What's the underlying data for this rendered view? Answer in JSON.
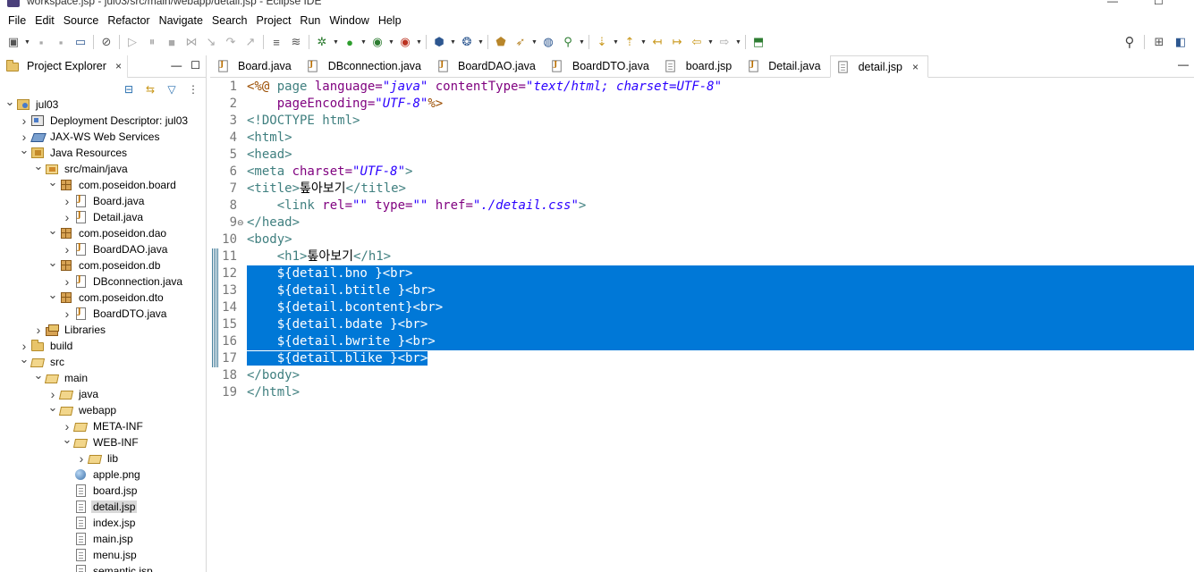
{
  "titlebar": {
    "text": "workspace.jsp - jul03/src/main/webapp/detail.jsp - Eclipse IDE",
    "minimize": "—",
    "maximize": "☐"
  },
  "menu": [
    "File",
    "Edit",
    "Source",
    "Refactor",
    "Navigate",
    "Search",
    "Project",
    "Run",
    "Window",
    "Help"
  ],
  "explorer": {
    "tab_label": "Project Explorer",
    "close": "×",
    "minimize": "—",
    "maximize": "☐",
    "tree": [
      {
        "label": "jul03",
        "level": 0,
        "twisty": "open",
        "icon": "project"
      },
      {
        "label": "Deployment Descriptor: jul03",
        "level": 1,
        "twisty": "closed",
        "icon": "deployment-descriptor"
      },
      {
        "label": "JAX-WS Web Services",
        "level": 1,
        "twisty": "closed",
        "icon": "web-services"
      },
      {
        "label": "Java Resources",
        "level": 1,
        "twisty": "open",
        "icon": "java-resources"
      },
      {
        "label": "src/main/java",
        "level": 2,
        "twisty": "open",
        "icon": "source-folder"
      },
      {
        "label": "com.poseidon.board",
        "level": 3,
        "twisty": "open",
        "icon": "package"
      },
      {
        "label": "Board.java",
        "level": 4,
        "twisty": "closed",
        "icon": "java-file"
      },
      {
        "label": "Detail.java",
        "level": 4,
        "twisty": "closed",
        "icon": "java-file"
      },
      {
        "label": "com.poseidon.dao",
        "level": 3,
        "twisty": "open",
        "icon": "package"
      },
      {
        "label": "BoardDAO.java",
        "level": 4,
        "twisty": "closed",
        "icon": "java-file"
      },
      {
        "label": "com.poseidon.db",
        "level": 3,
        "twisty": "open",
        "icon": "package"
      },
      {
        "label": "DBconnection.java",
        "level": 4,
        "twisty": "closed",
        "icon": "java-file"
      },
      {
        "label": "com.poseidon.dto",
        "level": 3,
        "twisty": "open",
        "icon": "package"
      },
      {
        "label": "BoardDTO.java",
        "level": 4,
        "twisty": "closed",
        "icon": "java-file"
      },
      {
        "label": "Libraries",
        "level": 2,
        "twisty": "closed",
        "icon": "libraries"
      },
      {
        "label": "build",
        "level": 1,
        "twisty": "closed",
        "icon": "folder"
      },
      {
        "label": "src",
        "level": 1,
        "twisty": "open",
        "icon": "open-folder"
      },
      {
        "label": "main",
        "level": 2,
        "twisty": "open",
        "icon": "open-folder"
      },
      {
        "label": "java",
        "level": 3,
        "twisty": "closed",
        "icon": "open-folder"
      },
      {
        "label": "webapp",
        "level": 3,
        "twisty": "open",
        "icon": "open-folder"
      },
      {
        "label": "META-INF",
        "level": 4,
        "twisty": "closed",
        "icon": "open-folder"
      },
      {
        "label": "WEB-INF",
        "level": 4,
        "twisty": "open",
        "icon": "open-folder"
      },
      {
        "label": "lib",
        "level": 5,
        "twisty": "closed",
        "icon": "open-folder"
      },
      {
        "label": "apple.png",
        "level": 4,
        "twisty": "none",
        "icon": "image-file"
      },
      {
        "label": "board.jsp",
        "level": 4,
        "twisty": "none",
        "icon": "jsp-file"
      },
      {
        "label": "detail.jsp",
        "level": 4,
        "twisty": "none",
        "icon": "jsp-file",
        "selected": true
      },
      {
        "label": "index.jsp",
        "level": 4,
        "twisty": "none",
        "icon": "jsp-file"
      },
      {
        "label": "main.jsp",
        "level": 4,
        "twisty": "none",
        "icon": "jsp-file"
      },
      {
        "label": "menu.jsp",
        "level": 4,
        "twisty": "none",
        "icon": "jsp-file"
      },
      {
        "label": "semantic.jsp",
        "level": 4,
        "twisty": "none",
        "icon": "jsp-file"
      }
    ]
  },
  "editor": {
    "tabs": [
      {
        "label": "Board.java",
        "icon": "java-file",
        "active": false
      },
      {
        "label": "DBconnection.java",
        "icon": "java-file",
        "active": false
      },
      {
        "label": "BoardDAO.java",
        "icon": "java-file",
        "active": false
      },
      {
        "label": "BoardDTO.java",
        "icon": "java-file",
        "active": false
      },
      {
        "label": "board.jsp",
        "icon": "jsp-file",
        "active": false
      },
      {
        "label": "Detail.java",
        "icon": "java-file",
        "active": false
      },
      {
        "label": "detail.jsp",
        "icon": "jsp-file",
        "active": true
      }
    ],
    "tab_close": "×",
    "minimize": "—",
    "lines": [
      [
        {
          "t": "<%@ ",
          "c": "jsp"
        },
        {
          "t": "page ",
          "c": "tag"
        },
        {
          "t": "language=",
          "c": "attr"
        },
        {
          "t": "\"java\"",
          "c": "val"
        },
        {
          "t": " contentType=",
          "c": "attr"
        },
        {
          "t": "\"text/html; charset=UTF-8\"",
          "c": "val"
        }
      ],
      [
        {
          "t": "    pageEncoding=",
          "c": "attr"
        },
        {
          "t": "\"UTF-8\"",
          "c": "val"
        },
        {
          "t": "%>",
          "c": "jsp"
        }
      ],
      [
        {
          "t": "<!DOCTYPE html>",
          "c": "tag"
        }
      ],
      [
        {
          "t": "<html>",
          "c": "tag"
        }
      ],
      [
        {
          "t": "<head>",
          "c": "tag"
        }
      ],
      [
        {
          "t": "<meta ",
          "c": "tag"
        },
        {
          "t": "charset=",
          "c": "attr"
        },
        {
          "t": "\"UTF-8\"",
          "c": "val"
        },
        {
          "t": ">",
          "c": "tag"
        }
      ],
      [
        {
          "t": "<title>",
          "c": "tag"
        },
        {
          "t": "톺아보기",
          "c": "kor"
        },
        {
          "t": "</title>",
          "c": "tag"
        }
      ],
      [
        {
          "t": "    <link ",
          "c": "tag"
        },
        {
          "t": "rel=",
          "c": "attr"
        },
        {
          "t": "\"\"",
          "c": "val"
        },
        {
          "t": " type=",
          "c": "attr"
        },
        {
          "t": "\"\"",
          "c": "val"
        },
        {
          "t": " href=",
          "c": "attr"
        },
        {
          "t": "\"./detail.css\"",
          "c": "val"
        },
        {
          "t": ">",
          "c": "tag"
        }
      ],
      [
        {
          "t": "</head>",
          "c": "tag"
        }
      ],
      [
        {
          "t": "<body>",
          "c": "tag"
        }
      ],
      [
        {
          "t": "    <h1>",
          "c": "tag"
        },
        {
          "t": "톺아보기",
          "c": "kor"
        },
        {
          "t": "</h1>",
          "c": "tag"
        }
      ],
      [
        {
          "t": "    ${detail.bno }",
          "c": "txt"
        },
        {
          "t": "<br>",
          "c": "tag"
        }
      ],
      [
        {
          "t": "    ${detail.btitle }",
          "c": "txt"
        },
        {
          "t": "<br>",
          "c": "tag"
        }
      ],
      [
        {
          "t": "    ${detail.bcontent}",
          "c": "txt"
        },
        {
          "t": "<br>",
          "c": "tag"
        }
      ],
      [
        {
          "t": "    ${detail.bdate }",
          "c": "txt"
        },
        {
          "t": "<br>",
          "c": "tag"
        }
      ],
      [
        {
          "t": "    ${detail.bwrite }",
          "c": "txt"
        },
        {
          "t": "<br>",
          "c": "tag"
        }
      ],
      [
        {
          "t": "    ${detail.blike }",
          "c": "txt"
        },
        {
          "t": "<br>",
          "c": "tag"
        }
      ],
      [
        {
          "t": "</body>",
          "c": "tag"
        }
      ],
      [
        {
          "t": "</html>",
          "c": "tag"
        }
      ]
    ],
    "selected_full_lines": [
      11,
      12,
      13,
      14,
      15
    ],
    "selected_partial_line": 16,
    "changed_lines": [
      10,
      11,
      12,
      13,
      14,
      15,
      16
    ],
    "fold_line": 8,
    "fold_glyph": "⊖"
  },
  "colors": {
    "selection": "#0078d7",
    "jsp_directive": "#9b4d00",
    "tag": "#3f7f7f",
    "attribute": "#7f007f",
    "value": "#2a00ff"
  }
}
